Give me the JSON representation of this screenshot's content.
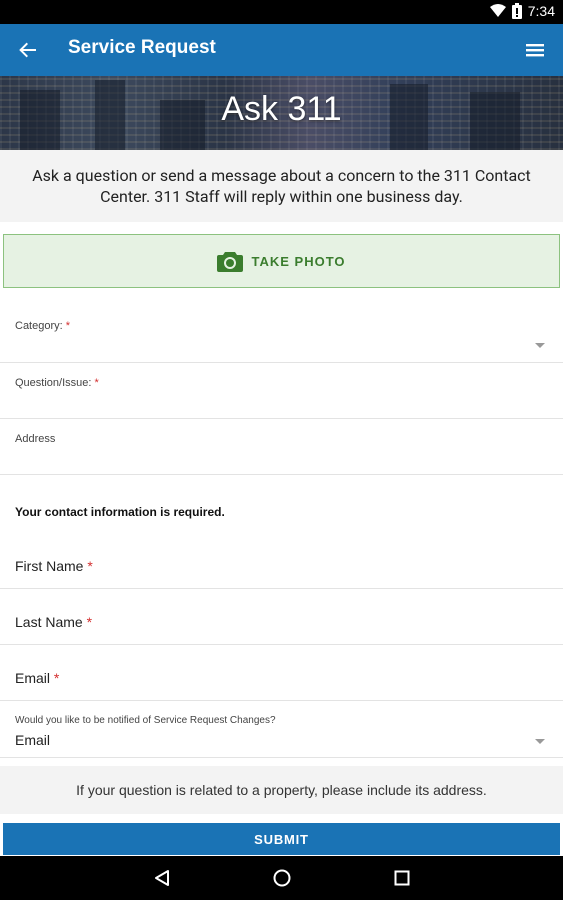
{
  "status_bar": {
    "time": "7:34"
  },
  "app_bar": {
    "title": "Service Request"
  },
  "hero": {
    "title": "Ask 311"
  },
  "intro": {
    "text": "Ask a question or send a message about a concern to the 311 Contact Center. 311 Staff will reply within one business day."
  },
  "take_photo": {
    "label": "TAKE PHOTO"
  },
  "form": {
    "category": {
      "label": "Category:",
      "required": "*"
    },
    "question": {
      "label": "Question/Issue:",
      "required": "*"
    },
    "address": {
      "label": "Address"
    },
    "contact_note": "Your contact information is required.",
    "first_name": {
      "label": "First Name",
      "required": "*"
    },
    "last_name": {
      "label": "Last Name",
      "required": "*"
    },
    "email": {
      "label": "Email",
      "required": "*"
    },
    "notify": {
      "label": "Would you like to be notified of Service Request Changes?",
      "value": "Email"
    }
  },
  "notice": "If your question is related to a property, please include its address.",
  "submit": {
    "label": "SUBMIT"
  },
  "colors": {
    "primary": "#1a73b5",
    "photo_bg": "#e6f2e3",
    "photo_text": "#3b7d2e",
    "required": "#d32f2f"
  }
}
